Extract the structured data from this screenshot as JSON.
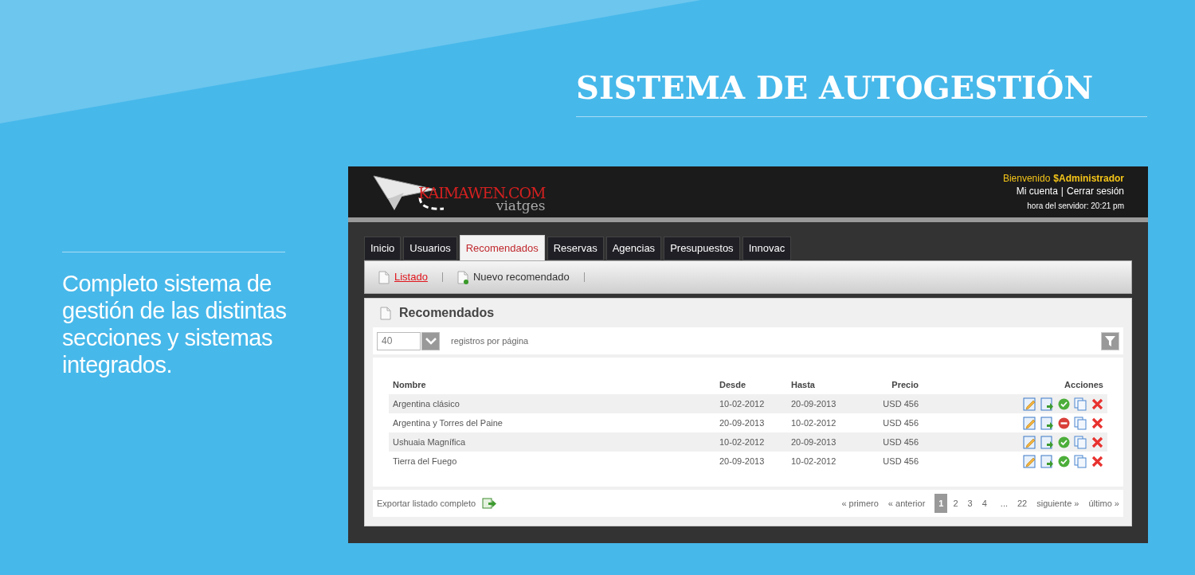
{
  "heading": "SISTEMA DE AUTOGESTIÓN",
  "description": "Completo sistema de gestión de las distintas secciones y sistemas integrados.",
  "app": {
    "logo": {
      "brand": "KAIMAWEN.COM",
      "sub": "viatges"
    },
    "user": {
      "greeting": "Bienvenido",
      "name": "$Administrador",
      "account": "Mi cuenta",
      "separator": "|",
      "logout": "Cerrar sesión",
      "server_time": "hora del servidor: 20:21 pm"
    },
    "tabs": [
      {
        "label": "Inicio",
        "selected": false
      },
      {
        "label": "Usuarios",
        "selected": false
      },
      {
        "label": "Recomendados",
        "selected": true
      },
      {
        "label": "Reservas",
        "selected": false
      },
      {
        "label": "Agencias",
        "selected": false
      },
      {
        "label": "Presupuestos",
        "selected": false
      },
      {
        "label": "Innovac",
        "selected": false
      }
    ],
    "subnav": [
      {
        "label": "Listado",
        "kind": "list",
        "selected": true
      },
      {
        "label": "Nuevo recomendado",
        "kind": "new",
        "selected": false
      }
    ],
    "panel": {
      "title": "Recomendados",
      "page_size": "40",
      "page_size_label": "registros por página",
      "columns": [
        "Nombre",
        "Desde",
        "Hasta",
        "Precio",
        "Acciones"
      ],
      "rows": [
        {
          "name": "Argentina clásico",
          "from": "10-02-2012",
          "to": "20-09-2013",
          "price": "USD 456",
          "active": true
        },
        {
          "name": "Argentina y Torres del Paine",
          "from": "20-09-2013",
          "to": "10-02-2012",
          "price": "USD 456",
          "active": false
        },
        {
          "name": "Ushuaia Magnífica",
          "from": "10-02-2012",
          "to": "20-09-2013",
          "price": "USD 456",
          "active": true
        },
        {
          "name": "Tierra del Fuego",
          "from": "20-09-2013",
          "to": "10-02-2012",
          "price": "USD 456",
          "active": true
        }
      ],
      "export": "Exportar listado completo",
      "pagination": {
        "first": "« primero",
        "prev": "« anterior",
        "pages": [
          {
            "label": "1",
            "selected": true
          },
          {
            "label": "2",
            "selected": false
          },
          {
            "label": "3",
            "selected": false
          },
          {
            "label": "4",
            "selected": false
          }
        ],
        "ellipsis": "...",
        "last_page": "22",
        "next": "siguiente »",
        "last": "último »"
      }
    }
  }
}
